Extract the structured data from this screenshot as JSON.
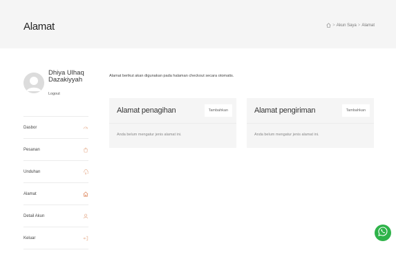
{
  "page": {
    "title": "Alamat"
  },
  "breadcrumb": {
    "items": [
      "Akun Saya",
      "Alamat"
    ],
    "separator": ">"
  },
  "user": {
    "name": "Dhiya Ulhaq Dazakiyyah",
    "logout_label": "Logout"
  },
  "menu": {
    "items": [
      {
        "label": "Dasbor",
        "icon": "dashboard-icon"
      },
      {
        "label": "Pesanan",
        "icon": "shopping-bag-icon"
      },
      {
        "label": "Unduhan",
        "icon": "download-icon"
      },
      {
        "label": "Alamat",
        "icon": "home-icon",
        "active": true
      },
      {
        "label": "Detail Akun",
        "icon": "user-icon"
      },
      {
        "label": "Keluar",
        "icon": "logout-icon"
      }
    ]
  },
  "main": {
    "intro": "Alamat berikut akan digunakan pada halaman checkout secara otomatis.",
    "billing": {
      "title": "Alamat penagihan",
      "add_label": "Tambahkan",
      "empty_text": "Anda belum mengatur jenis alamat ini."
    },
    "shipping": {
      "title": "Alamat pengiriman",
      "add_label": "Tambahkan",
      "empty_text": "Anda belum mengatur jenis alamat ini."
    }
  },
  "colors": {
    "accent": "#e0916a",
    "header_bg": "#f5f5f5",
    "card_bg": "#f5f5f5",
    "whatsapp": "#2fb34a"
  },
  "icons": {
    "whatsapp": "whatsapp-icon",
    "breadcrumb_home": "home-icon",
    "avatar": "avatar-placeholder"
  }
}
